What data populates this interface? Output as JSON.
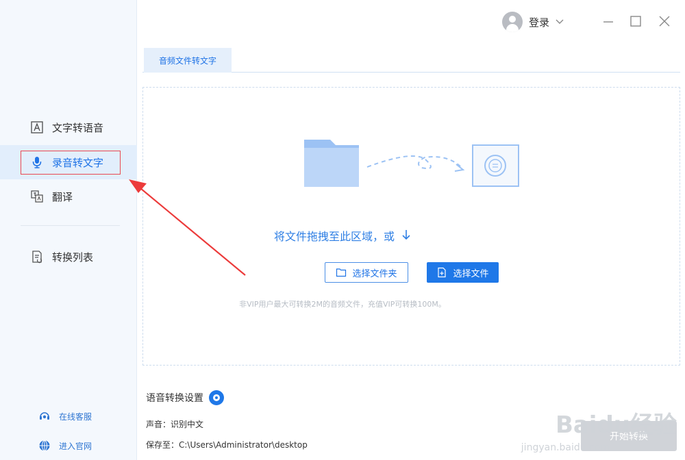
{
  "sidebar": {
    "items": [
      {
        "label": "文字转语音",
        "icon": "text-a-icon"
      },
      {
        "label": "录音转文字",
        "icon": "microphone-icon",
        "active": true
      },
      {
        "label": "翻译",
        "icon": "translate-icon"
      },
      {
        "label": "转换列表",
        "icon": "convert-list-icon"
      }
    ],
    "bottom": [
      {
        "label": "在线客服",
        "icon": "headset-icon"
      },
      {
        "label": "进入官网",
        "icon": "globe-icon"
      }
    ]
  },
  "header": {
    "login_label": "登录"
  },
  "tabs": [
    {
      "label": "音频文件转文字",
      "active": true
    }
  ],
  "dropzone": {
    "prompt": "将文件拖拽至此区域，或",
    "select_folder_label": "选择文件夹",
    "select_file_label": "选择文件",
    "hint": "非VIP用户最大可转换2M的音频文件，充值VIP可转换100M。"
  },
  "settings": {
    "title": "语音转换设置",
    "voice_line": "声音：识别中文",
    "save_line": "保存至：C:\\Users\\Administrator\\desktop"
  },
  "convert_button_label": "开始转换",
  "watermark": {
    "main": "Baidu经验",
    "sub": "jingyan.baidu.com"
  },
  "colors": {
    "accent": "#1f78e8",
    "sidebar_bg": "#f4f8fd",
    "highlight_red": "#e8484f"
  }
}
